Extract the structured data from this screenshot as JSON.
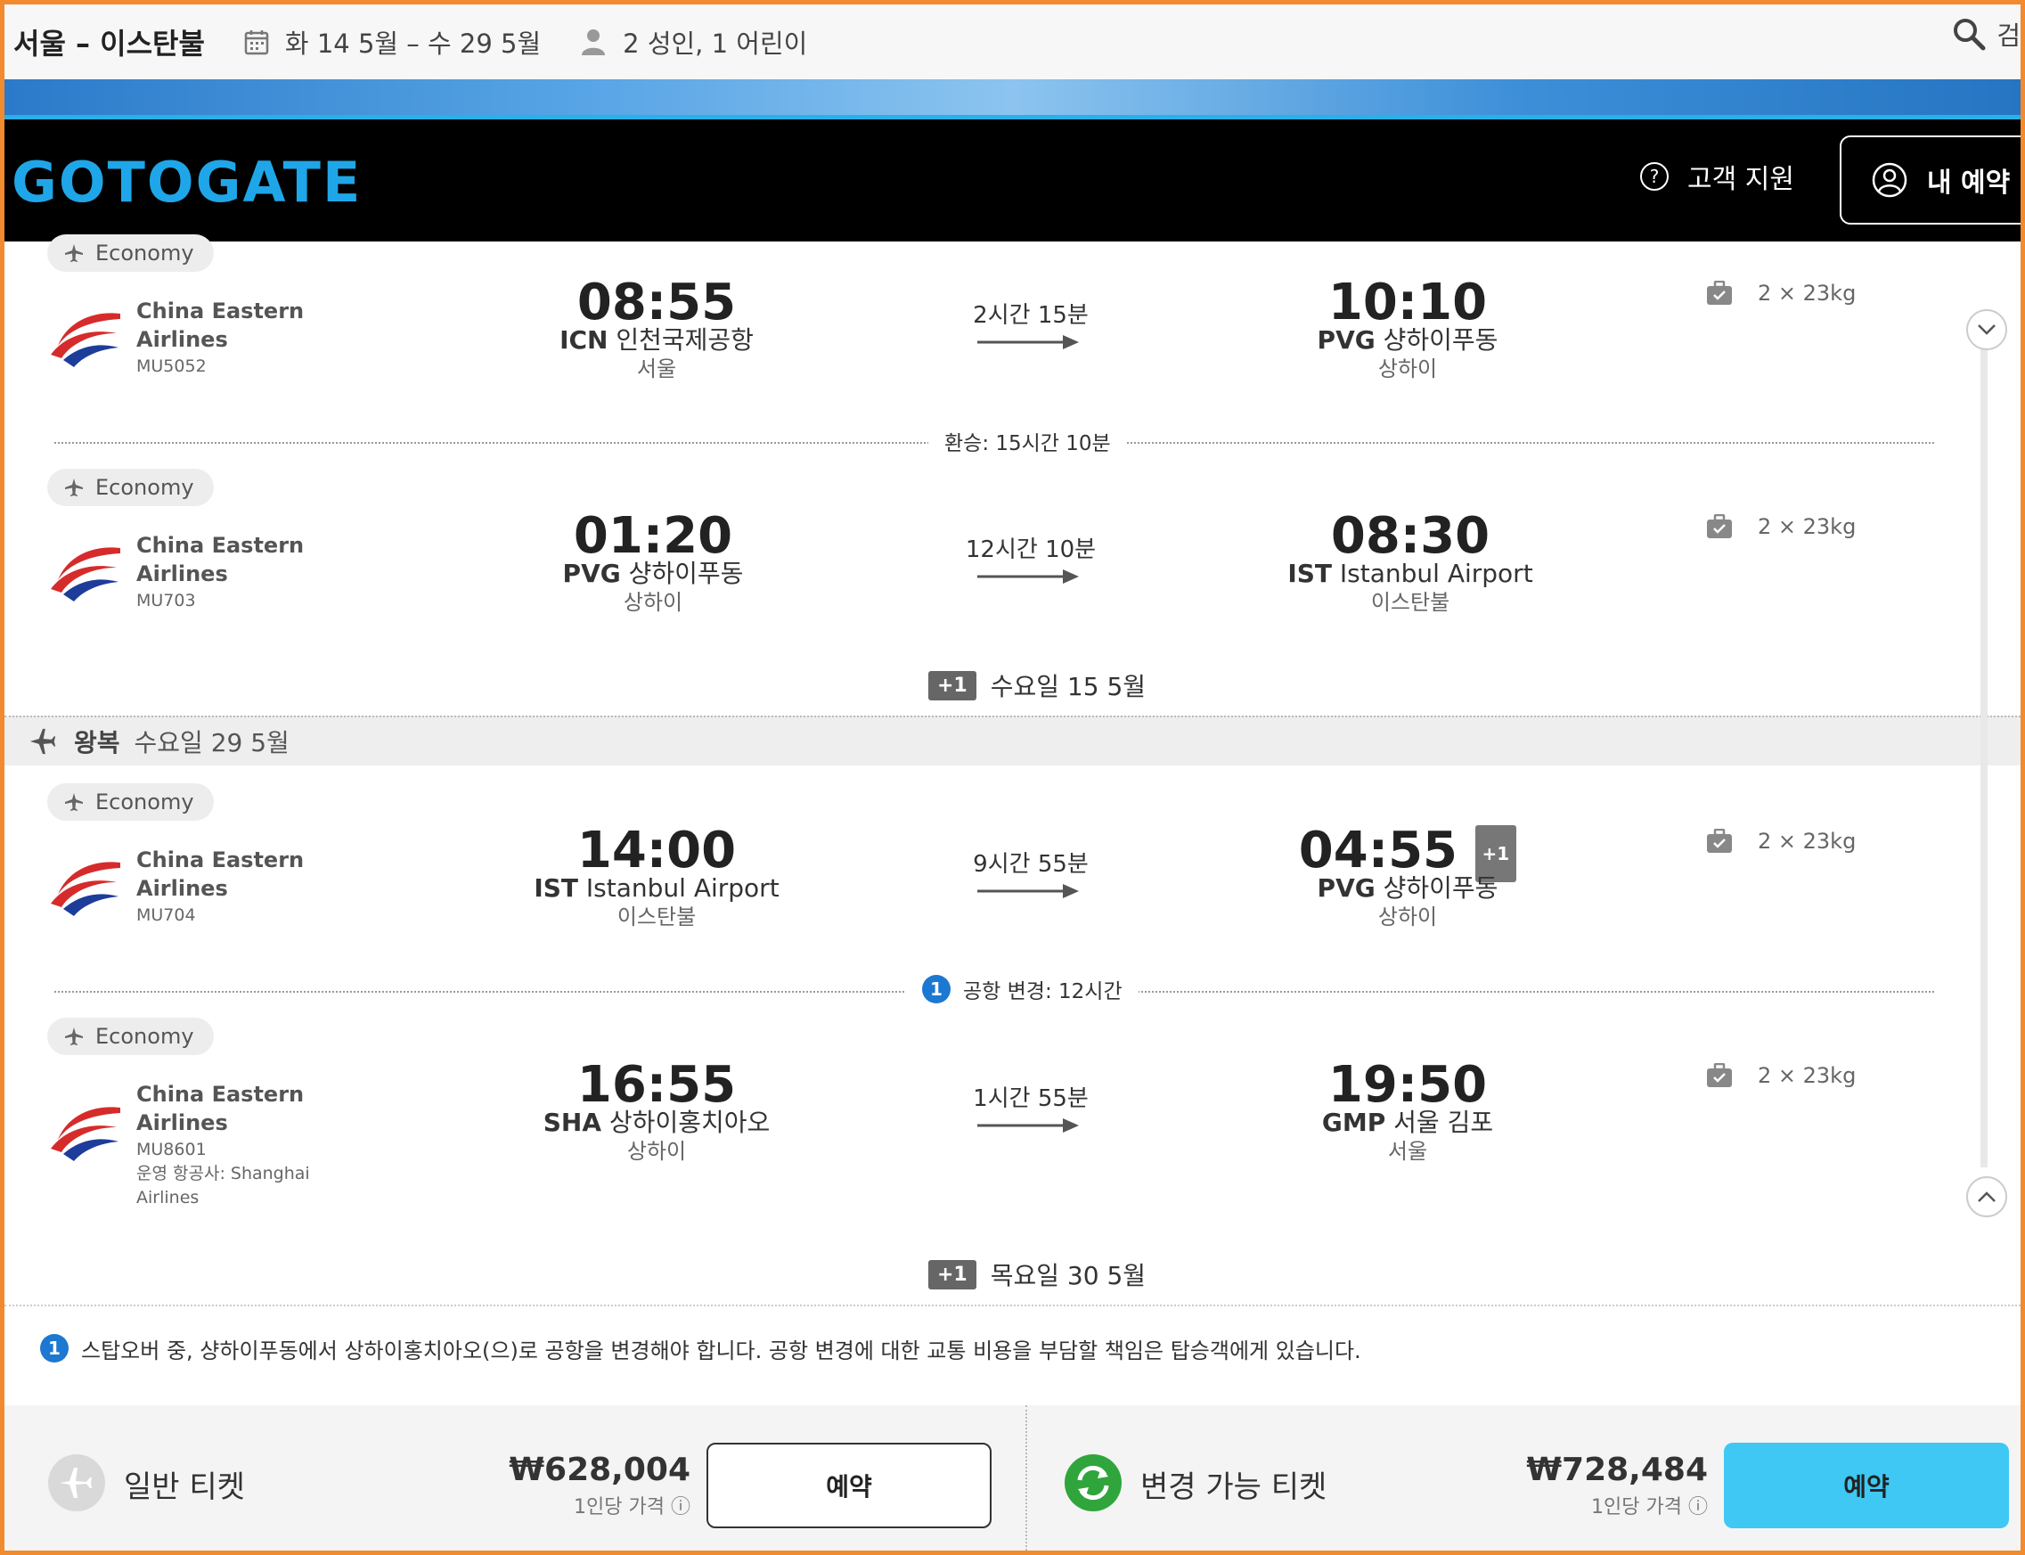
{
  "search": {
    "route": "서울 – 이스탄불",
    "dates": "화 14 5월 – 수 29 5월",
    "passengers": "2 성인, 1 어린이",
    "search_label": "검"
  },
  "header": {
    "logo": "GOTOGATE",
    "support_label": "고객 지원",
    "my_booking_label": "내 예약"
  },
  "cabin_label": "Economy",
  "outbound": {
    "segments": [
      {
        "airline": "China Eastern Airlines",
        "flight_no": "MU5052",
        "dep_time": "08:55",
        "dep_code": "ICN",
        "dep_airport": "인천국제공항",
        "dep_city": "서울",
        "duration": "2시간 15분",
        "arr_time": "10:10",
        "arr_code": "PVG",
        "arr_airport": "샹하이푸동",
        "arr_city": "상하이",
        "baggage": "2 × 23kg"
      },
      {
        "airline": "China Eastern Airlines",
        "flight_no": "MU703",
        "dep_time": "01:20",
        "dep_code": "PVG",
        "dep_airport": "샹하이푸동",
        "dep_city": "상하이",
        "duration": "12시간 10분",
        "arr_time": "08:30",
        "arr_code": "IST",
        "arr_airport": "Istanbul Airport",
        "arr_city": "이스탄불",
        "baggage": "2 × 23kg"
      }
    ],
    "layover": "환승: 15시간 10분",
    "arrival_day_badge": "+1",
    "arrival_day": "수요일 15 5월"
  },
  "return": {
    "label": "왕복",
    "date": "수요일 29 5월",
    "segments": [
      {
        "airline": "China Eastern Airlines",
        "flight_no": "MU704",
        "dep_time": "14:00",
        "dep_code": "IST",
        "dep_airport": "Istanbul Airport",
        "dep_city": "이스탄불",
        "duration": "9시간 55분",
        "arr_time": "04:55",
        "arr_badge": "+1",
        "arr_code": "PVG",
        "arr_airport": "샹하이푸동",
        "arr_city": "상하이",
        "baggage": "2 × 23kg"
      },
      {
        "airline": "China Eastern Airlines",
        "flight_no": "MU8601",
        "operated_by": "운영 항공사: Shanghai Airlines",
        "dep_time": "16:55",
        "dep_code": "SHA",
        "dep_airport": "상하이홍치아오",
        "dep_city": "상하이",
        "duration": "1시간 55분",
        "arr_time": "19:50",
        "arr_code": "GMP",
        "arr_airport": "서울 김포",
        "arr_city": "서울",
        "baggage": "2 × 23kg"
      }
    ],
    "layover_index": "1",
    "layover": "공항 변경: 12시간",
    "arrival_day_badge": "+1",
    "arrival_day": "목요일 30 5월"
  },
  "notice": {
    "index": "1",
    "text": "스탑오버 중, 샹하이푸동에서 상하이홍치아오(으)로 공항을 변경해야 합니다. 공항 변경에 대한 교통 비용을 부담할 책임은 탑승객에게 있습니다."
  },
  "tickets": {
    "standard": {
      "label": "일반 티켓",
      "price": "₩628,004",
      "price_note": "1인당 가격",
      "button": "예약"
    },
    "flexible": {
      "label": "변경 가능 티켓",
      "price": "₩728,484",
      "price_note": "1인당 가격",
      "button": "예약"
    }
  },
  "colors": {
    "accent": "#1fa6e8",
    "book_button_flex": "#3fc8f4",
    "frame": "#f28a2e",
    "info_blue": "#1c78d0",
    "flex_green": "#2fa53c"
  }
}
